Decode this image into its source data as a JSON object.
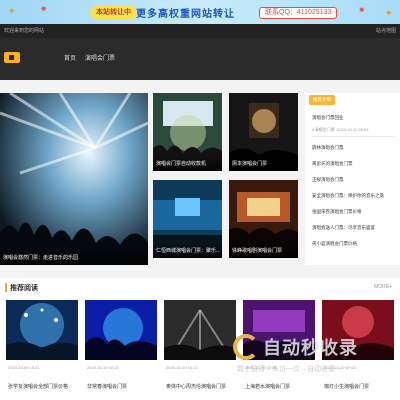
{
  "banner": {
    "tag": "本站转让中",
    "headline": "更多高权重网站转让",
    "contact": "联系QQ：411025133"
  },
  "topbar": {
    "left": "欢迎来到您的网站",
    "right": "站点地图"
  },
  "nav": {
    "items": [
      "首页",
      "演唱会门票"
    ]
  },
  "featured": {
    "main_caption": "演唱会悠然门票：走进音乐的乐园",
    "grid": [
      {
        "caption": "演唱会门票自动收款机"
      },
      {
        "caption": "厕本演唱会门票"
      },
      {
        "caption": "仁恒西城演唱会门票：聚乐..."
      },
      {
        "caption": "徐峥歌唱剧演唱会门票"
      }
    ]
  },
  "sidebar": {
    "header": "推荐文章",
    "items": [
      {
        "title": "演唱会门票回业",
        "meta_tag": "K演唱会门票",
        "date": "2024-10-10 09:24"
      },
      {
        "title": "薛林演唱会门票"
      },
      {
        "title": "黄思买的演唱会门票"
      },
      {
        "title": "正规演唱会门票"
      },
      {
        "title": "安全演唱会门票：保护你的音乐之旅"
      },
      {
        "title": "张国荣卷演唱会门票价格"
      },
      {
        "title": "演唱会送人门票：尽享音乐盛宴"
      },
      {
        "title": "央小蓝演唱会门票价格"
      }
    ]
  },
  "recommended": {
    "title": "推荐阅读",
    "more": "MORE+",
    "cards": [
      {
        "date": "2024-10-09 15:21",
        "title": "张学友演唱会全部门票价格"
      },
      {
        "date": "2024-10-10 10:33",
        "title": "非常春演唱会门票"
      },
      {
        "date": "2024-10-10 10:11",
        "title": "奥体中心周杰伦演唱会门票"
      },
      {
        "date": "2024-10-10 07:56",
        "title": "上海若水演唱会门票"
      },
      {
        "date": "2024-10-10 07:04",
        "title": "咖灯小生演唱会门票"
      }
    ]
  },
  "watermark": {
    "title": "自动秒收录",
    "sub": "数上链接→未访一次→自动收录→"
  },
  "colors": {
    "accent": "#f5a623",
    "nav_bg": "#2a2a2a",
    "brand_blue": "#1a56c9"
  }
}
